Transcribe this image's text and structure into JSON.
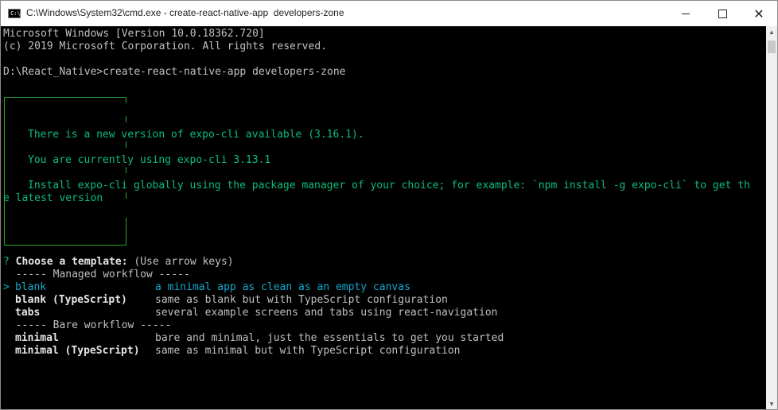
{
  "window": {
    "title": "C:\\Windows\\System32\\cmd.exe - create-react-native-app  developers-zone",
    "icon": "cmd-icon",
    "icon_text": "C:\\"
  },
  "console": {
    "header_1": "Microsoft Windows [Version 10.0.18362.720]",
    "header_2": "(c) 2019 Microsoft Corporation. All rights reserved.",
    "prompt": "D:\\React_Native>create-react-native-app developers-zone",
    "notice_1": "There is a new version of expo-cli available (3.16.1).",
    "notice_2": "You are currently using expo-cli 3.13.1",
    "notice_3a": "Install expo-cli globally using the package manager of your choice; for example: `npm install -g expo-cli` to get th",
    "notice_3b": "e latest version",
    "question_mark": "?",
    "question": "Choose a template:",
    "question_hint": " (Use arrow keys)",
    "managed_header": "  ----- Managed workflow -----",
    "pointer": ">",
    "templates": [
      {
        "name": "blank",
        "description": "a minimal app as clean as an empty canvas"
      },
      {
        "name": "blank (TypeScript)",
        "description": "same as blank but with TypeScript configuration"
      },
      {
        "name": "tabs",
        "description": "several example screens and tabs using react-navigation"
      }
    ],
    "bare_header": "  ----- Bare workflow -----",
    "bare_templates": [
      {
        "name": "minimal",
        "description": "bare and minimal, just the essentials to get you started"
      },
      {
        "name": "minimal (TypeScript)",
        "description": "same as minimal but with TypeScript configuration"
      }
    ]
  },
  "colors": {
    "background": "#000000",
    "text": "#c0c0c0",
    "green": "#0dbc79",
    "selected": "#11a8cd"
  }
}
